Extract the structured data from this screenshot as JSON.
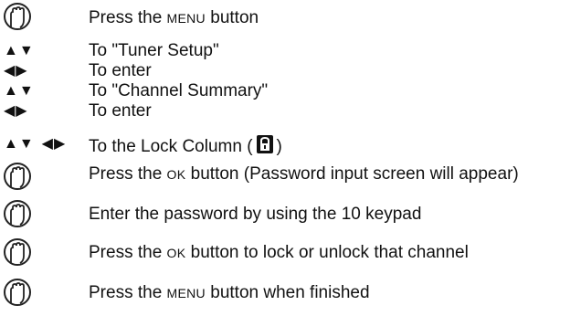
{
  "steps": [
    {
      "icon": "press-hand-icon",
      "prefix": "Press the ",
      "key": "Menu",
      "suffix": " button"
    },
    {
      "icon": "up-down-arrows-icon",
      "text": "To \"Tuner Setup\""
    },
    {
      "icon": "left-right-arrows-icon",
      "text": "To enter"
    },
    {
      "icon": "up-down-arrows-icon",
      "text": "To \"Channel Summary\""
    },
    {
      "icon": "left-right-arrows-icon",
      "text": "To enter"
    },
    {
      "icon": "all-arrows-icon",
      "prefix": "To the Lock Column (",
      "suffix": ")"
    },
    {
      "icon": "press-hand-icon",
      "prefix": "Press the ",
      "key": "Ok",
      "suffix": " button (Password input screen will appear)"
    },
    {
      "icon": "press-hand-icon",
      "text": "Enter the password by using the 10 keypad"
    },
    {
      "icon": "press-hand-icon",
      "prefix": "Press the ",
      "key": "Ok",
      "suffix": " button to lock or unlock that channel"
    },
    {
      "icon": "press-hand-icon",
      "prefix": "Press the ",
      "key": "Menu",
      "suffix": " button when finished"
    }
  ]
}
